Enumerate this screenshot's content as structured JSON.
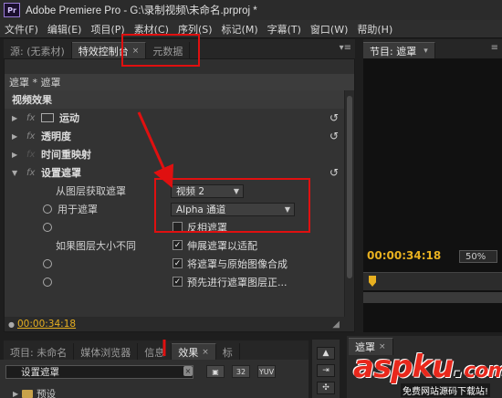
{
  "window": {
    "logo": "Pr",
    "title": "Adobe Premiere Pro - G:\\录制视频\\未命名.prproj *"
  },
  "menu": [
    "文件(F)",
    "编辑(E)",
    "项目(P)",
    "素材(C)",
    "序列(S)",
    "标记(M)",
    "字幕(T)",
    "窗口(W)",
    "帮助(H)"
  ],
  "source_tabs": {
    "source": "源: (无素材)",
    "effect_controls": "特效控制台",
    "metadata": "元数据",
    "close": "×"
  },
  "program_tab": {
    "label": "节目: 遮罩",
    "arrow": "▾"
  },
  "effect_controls": {
    "header": "遮罩 * 遮罩",
    "section": "视频效果",
    "effects": [
      {
        "name": "运动"
      },
      {
        "name": "透明度"
      },
      {
        "name": "时间重映射"
      },
      {
        "name": "设置遮罩"
      }
    ],
    "fx_label": "fx",
    "reset_glyph": "↺",
    "props": {
      "get_matte_label": "从图层获取遮罩",
      "get_matte_value": "视频 2",
      "use_for_label": "用于遮罩",
      "use_for_value": "Alpha 通道",
      "size_differ_label": "如果图层大小不同"
    },
    "checks": [
      {
        "label": "反相遮罩",
        "checked": false
      },
      {
        "label": "伸展遮罩以适配",
        "checked": true
      },
      {
        "label": "将遮罩与原始图像合成",
        "checked": true
      },
      {
        "label": "预先进行遮罩图层正...",
        "checked": true
      }
    ],
    "footer_timecode": "00:00:34:18"
  },
  "program_monitor": {
    "timecode": "00:00:34:18",
    "zoom": "50%"
  },
  "project_tabs": [
    "项目: 未命名",
    "媒体浏览器",
    "信息",
    "效果",
    "标"
  ],
  "effects_search": {
    "value": "设置遮罩",
    "buttons": [
      "32",
      "YUV"
    ]
  },
  "tree_item": "预设",
  "mask_tab": "遮罩",
  "watermark": {
    "main": "aspku",
    "dot": ".",
    "tld": "com",
    "sub": "免费网站源码下载站!"
  }
}
